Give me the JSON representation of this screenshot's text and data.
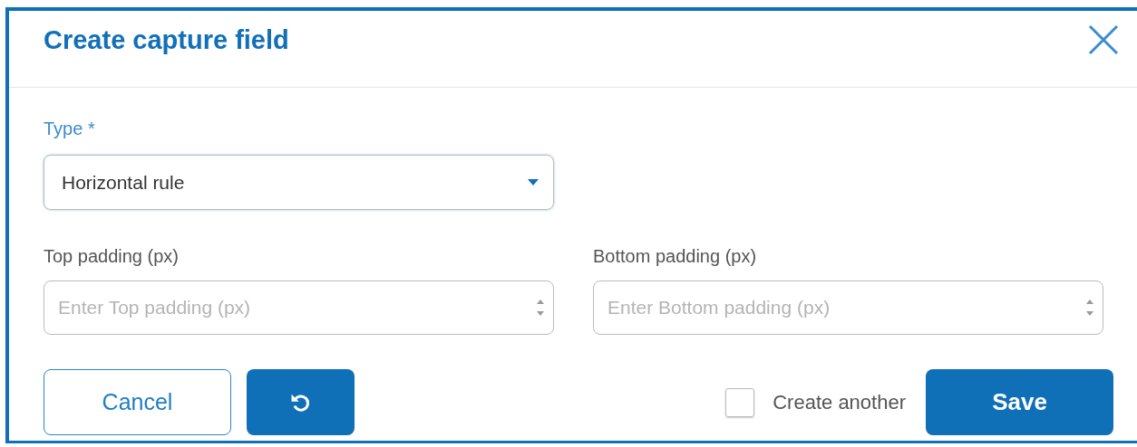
{
  "dialog": {
    "title": "Create capture field"
  },
  "type_field": {
    "label": "Type *",
    "value": "Horizontal rule"
  },
  "padding_fields": [
    {
      "label": "Top padding (px)",
      "placeholder": "Enter Top padding (px)"
    },
    {
      "label": "Bottom padding (px)",
      "placeholder": "Enter Bottom padding (px)"
    }
  ],
  "footer": {
    "cancel": "Cancel",
    "create_another": {
      "label": "Create another",
      "checked": false
    },
    "save": "Save"
  }
}
